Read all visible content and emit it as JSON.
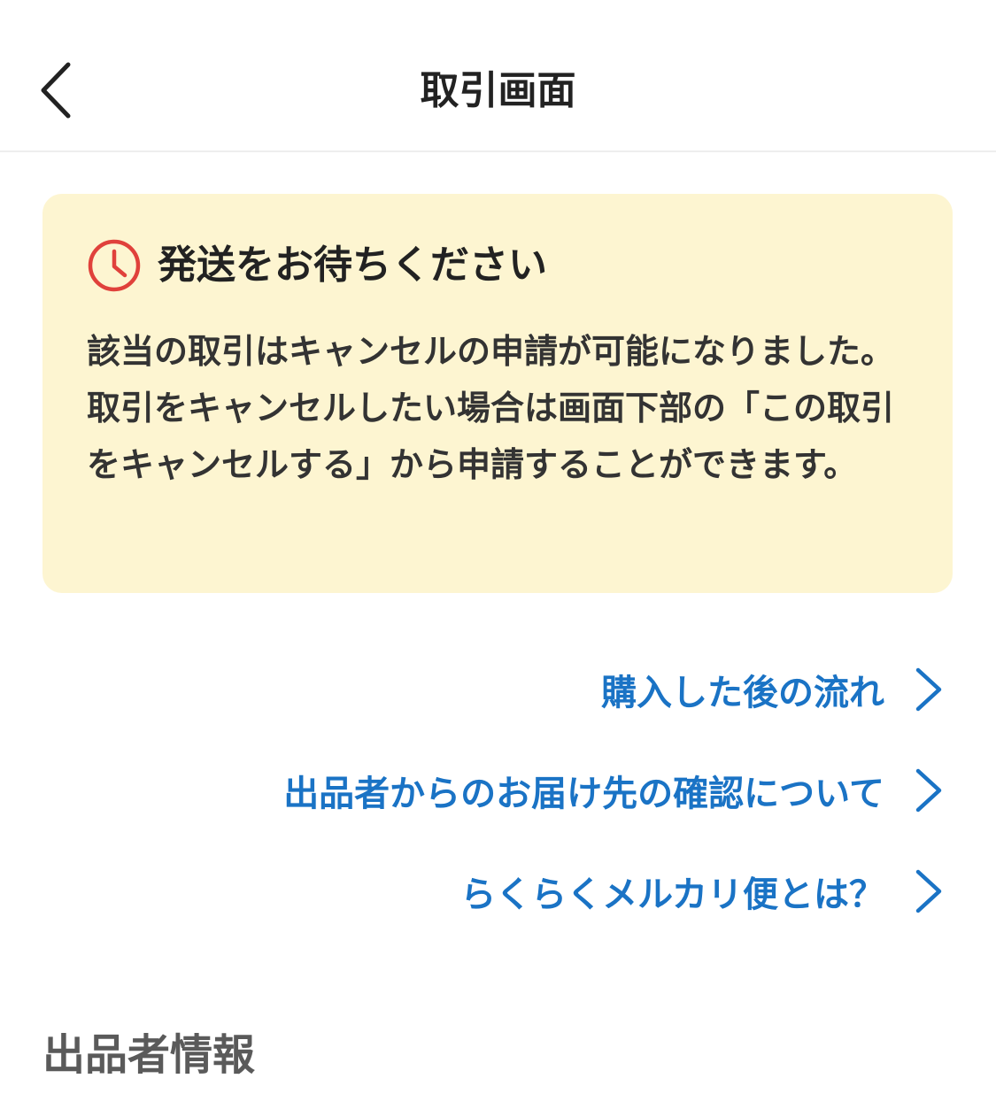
{
  "header": {
    "title": "取引画面",
    "back_icon": "chevron-left-icon"
  },
  "notice": {
    "icon": "clock-icon",
    "icon_color": "#e0413b",
    "background_color": "#fdf5d1",
    "title": "発送をお待ちください",
    "body": "該当の取引はキャンセルの申請が可能になりました。取引をキャンセルしたい場合は画面下部の「この取引をキャンセルする」から申請することができます。"
  },
  "links": {
    "color": "#1a73c5",
    "items": [
      {
        "label": "購入した後の流れ",
        "icon": "chevron-right-icon"
      },
      {
        "label": "出品者からのお届け先の確認について",
        "icon": "chevron-right-icon"
      },
      {
        "label": "らくらくメルカリ便とは？",
        "icon": "chevron-right-icon"
      }
    ]
  },
  "seller_section": {
    "heading": "出品者情報"
  }
}
